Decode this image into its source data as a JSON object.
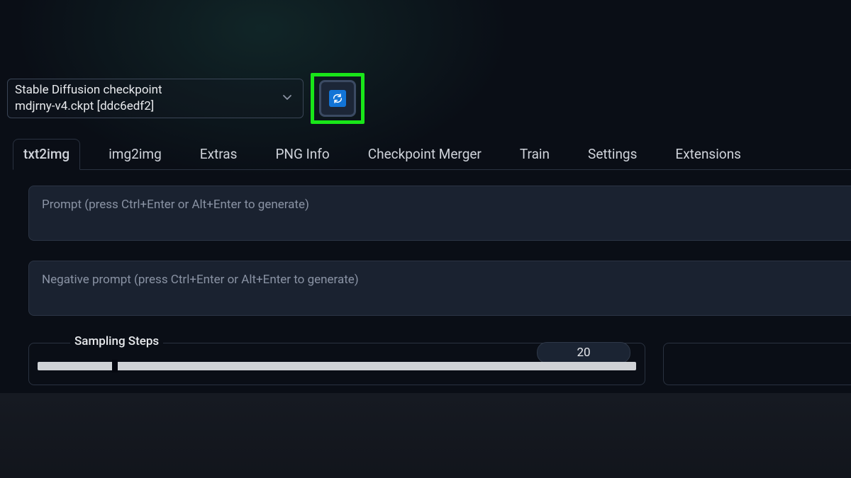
{
  "checkpoint": {
    "label": "Stable Diffusion checkpoint",
    "value": "mdjrny-v4.ckpt [ddc6edf2]"
  },
  "tabs": [
    {
      "label": "txt2img",
      "active": true
    },
    {
      "label": "img2img"
    },
    {
      "label": "Extras"
    },
    {
      "label": "PNG Info"
    },
    {
      "label": "Checkpoint Merger"
    },
    {
      "label": "Train"
    },
    {
      "label": "Settings"
    },
    {
      "label": "Extensions"
    }
  ],
  "prompt": {
    "placeholder": "Prompt (press Ctrl+Enter or Alt+Enter to generate)"
  },
  "negative_prompt": {
    "placeholder": "Negative prompt (press Ctrl+Enter or Alt+Enter to generate)"
  },
  "sampling": {
    "label": "Sampling Steps",
    "value": "20"
  }
}
